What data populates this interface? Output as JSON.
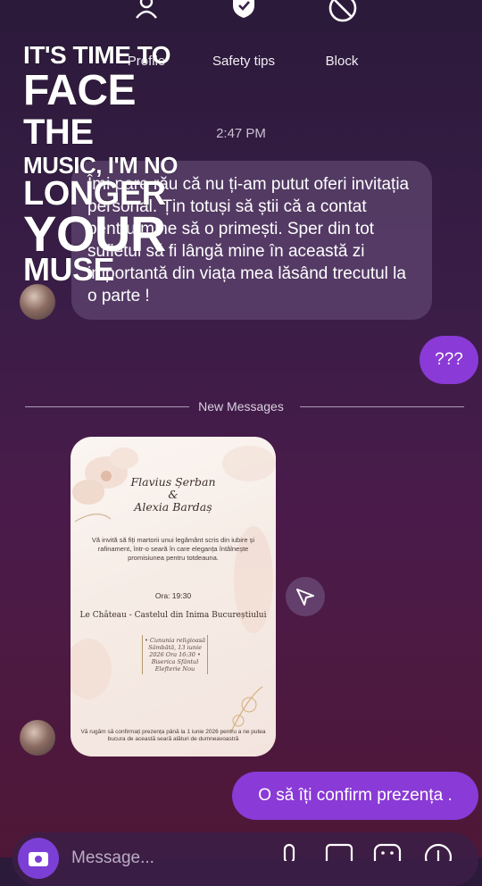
{
  "header": {
    "actions": [
      {
        "label": "Profile",
        "icon": "profile-icon"
      },
      {
        "label": "Safety tips",
        "icon": "shield-icon"
      },
      {
        "label": "Block",
        "icon": "block-icon"
      }
    ]
  },
  "overlay": {
    "lines": [
      "IT'S TIME TO",
      "FACE",
      "THE",
      "MUSIC, I'M NO",
      "LONGER",
      "YOUR",
      "MUSE"
    ]
  },
  "chat": {
    "time": "2:47 PM",
    "incoming_text": "Îmi pare rău că nu ți-am putut oferi invitația personal. Țin totuși să știi că a contat pentru mine să o primești. Sper din tot sufletul să fi lângă mine în această zi importantă din viața mea lăsând trecutul la o parte !",
    "outgoing_1": "???",
    "new_messages": "New Messages",
    "outgoing_2": "O să îți confirm prezența ."
  },
  "invitation": {
    "name1": "Flavius Șerban",
    "amp": "&",
    "name2": "Alexia Bardaș",
    "body": "Vă invită să fiți martorii unui legământ scris din iubire și rafinament, într-o seară în care eleganța întâlnește promisiunea pentru totdeauna.",
    "ora": "Ora: 19:30",
    "venue": "Le Château - Castelul din Inima Bucureștiului",
    "detail": "• Cununia religioasă Sâmbătă, 13 iunie 2026 Ora 16:30 • Biserica Sfântul Elefterie Nou",
    "footer": "Vă rugăm să confirmați prezența până la 1 iunie 2026 pentru a ne putea bucura de această seară alături de dumneavoastră"
  },
  "composer": {
    "placeholder": "Message..."
  },
  "colors": {
    "accent": "#8a3ad6",
    "bubble_in": "#6b5a80"
  }
}
